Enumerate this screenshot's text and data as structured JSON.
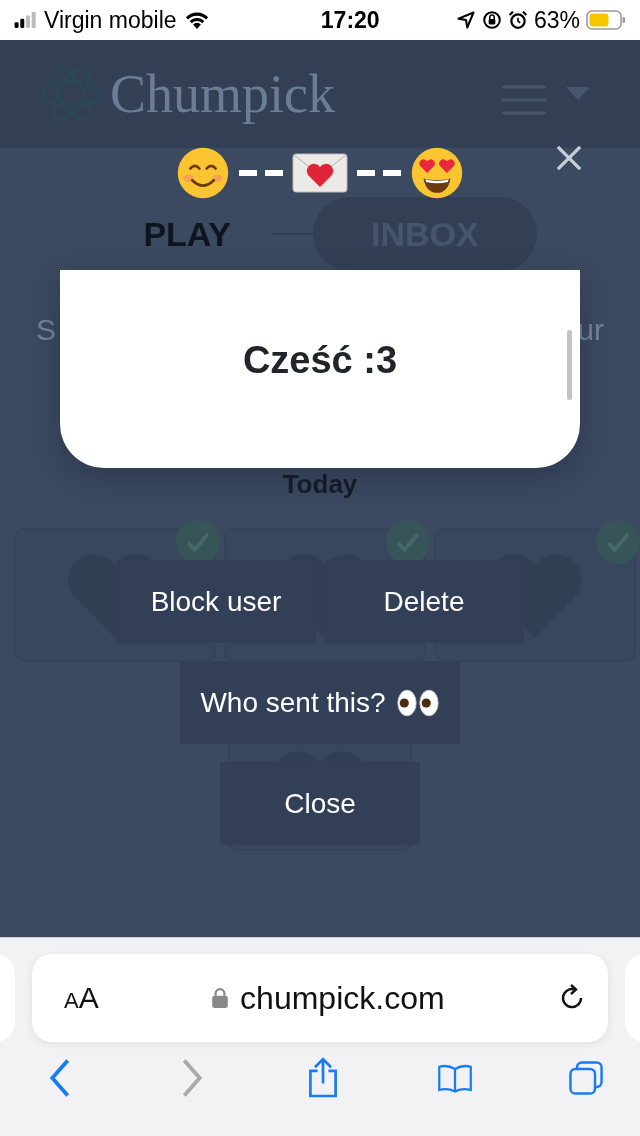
{
  "status_bar": {
    "carrier": "Virgin mobile",
    "time": "17:20",
    "battery": "63%"
  },
  "page": {
    "logo": "Chumpick",
    "tabs": [
      {
        "label": "PLAY",
        "selected": false
      },
      {
        "label": "INBOX",
        "selected": true
      }
    ],
    "intro_left": "S",
    "intro_right": "ur",
    "date_heading": "Today"
  },
  "modal": {
    "message": "Cześć :3",
    "buttons": [
      {
        "label": "Block user",
        "kind": "plain"
      },
      {
        "label": "Delete",
        "kind": "plain"
      },
      {
        "label": "Who sent this?",
        "kind": "reveal"
      },
      {
        "label": "Close",
        "kind": "plain"
      }
    ]
  },
  "browser": {
    "text_size": "AA",
    "url": "chumpick.com"
  }
}
